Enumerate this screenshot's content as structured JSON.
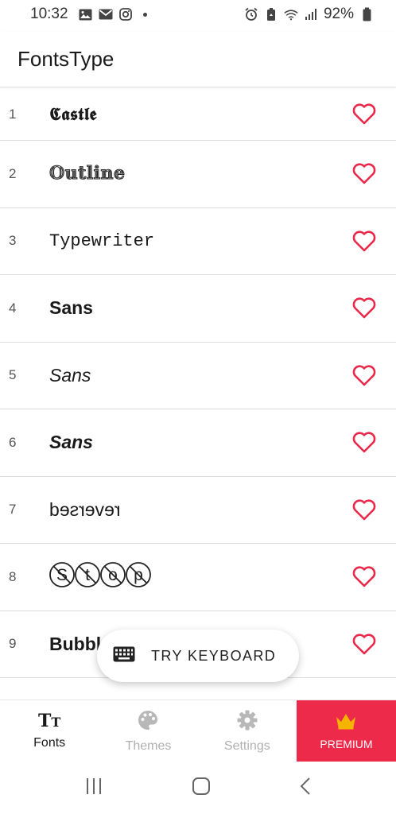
{
  "status_bar": {
    "time": "10:32",
    "battery": "92%",
    "left_icons": [
      "gallery-icon",
      "gmail-icon",
      "instagram-icon",
      "dot-icon"
    ],
    "right_icons": [
      "alarm-icon",
      "battery-saver-icon",
      "wifi-icon",
      "signal-icon",
      "battery-icon"
    ]
  },
  "app_bar": {
    "title": "FontsType"
  },
  "fonts": [
    {
      "num": "1",
      "sample": "𝕮𝖆𝖘𝖙𝖑𝖊",
      "style": "castle"
    },
    {
      "num": "2",
      "sample": "𝕆𝕦𝕥𝕝𝕚𝕟𝕖",
      "style": "outline"
    },
    {
      "num": "3",
      "sample": "Typewriter",
      "style": "typewriter"
    },
    {
      "num": "4",
      "sample": "Sans",
      "style": "bold"
    },
    {
      "num": "5",
      "sample": "Sans",
      "style": "italic"
    },
    {
      "num": "6",
      "sample": "Sans",
      "style": "bold-italic"
    },
    {
      "num": "7",
      "sample": "reversed",
      "style": "reversed"
    },
    {
      "num": "8",
      "sample": "Stop",
      "style": "stop"
    },
    {
      "num": "9",
      "sample": "Bubbles",
      "style": "bubbles"
    }
  ],
  "try_keyboard": {
    "label": "TRY KEYBOARD",
    "icon": "keyboard-icon"
  },
  "bottom_nav": {
    "items": [
      {
        "label": "Fonts",
        "icon": "text-size-icon",
        "active": true
      },
      {
        "label": "Themes",
        "icon": "palette-icon",
        "active": false
      },
      {
        "label": "Settings",
        "icon": "gear-icon",
        "active": false
      },
      {
        "label": "PREMIUM",
        "icon": "crown-icon",
        "active": false
      }
    ]
  },
  "colors": {
    "accent": "#ee2a4a",
    "heart": "#e8294a",
    "crown": "#f5b400",
    "inactive": "#b0b0b0"
  },
  "system_nav": [
    "recents-icon",
    "home-icon",
    "back-icon"
  ]
}
